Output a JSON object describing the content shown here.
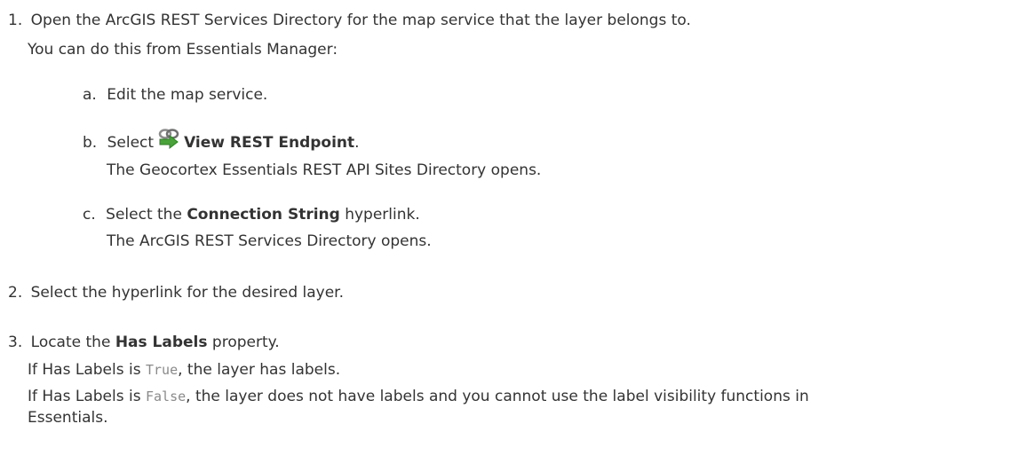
{
  "steps": [
    {
      "number": "1.",
      "text": "Open the ArcGIS REST Services Directory for the map service that the layer belongs to.",
      "note": "You can do this from Essentials Manager:",
      "substeps": [
        {
          "letter": "a.",
          "text": "Edit the map service."
        },
        {
          "letter": "b.",
          "prefix": "Select",
          "icon": "view-rest-endpoint-icon",
          "bold": "View REST Endpoint",
          "suffix": ".",
          "result": "The Geocortex Essentials REST API Sites Directory opens."
        },
        {
          "letter": "c.",
          "prefix": "Select the",
          "bold": "Connection String",
          "suffix": "hyperlink.",
          "result": "The ArcGIS REST Services Directory opens."
        }
      ]
    },
    {
      "number": "2.",
      "text": "Select the hyperlink for the desired layer."
    },
    {
      "number": "3.",
      "prefix": "Locate the",
      "bold": "Has Labels",
      "suffix": "property.",
      "true_prefix": "If Has Labels is",
      "true_code": "True",
      "true_suffix": ", the layer has labels.",
      "false_prefix": "If Has Labels is",
      "false_code": "False",
      "false_suffix": ", the layer does not have labels and you cannot use the label visibility functions in",
      "false_continuation": "Essentials."
    }
  ],
  "colors": {
    "text": "#333333",
    "code": "#8a8a8a",
    "icon_green": "#49a23a",
    "icon_gray": "#8c8c8c"
  }
}
